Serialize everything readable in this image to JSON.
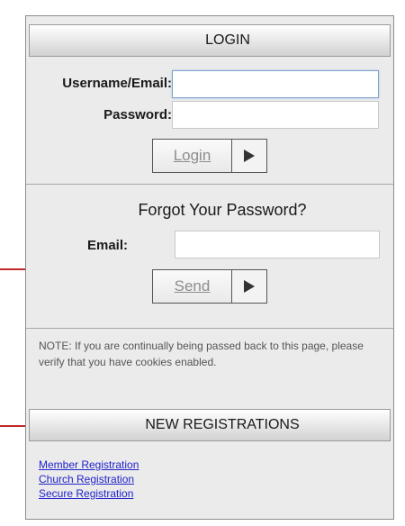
{
  "login": {
    "header": "LOGIN",
    "username_label": "Username/Email:",
    "username_value": "",
    "password_label": "Password:",
    "password_value": "",
    "login_button": "Login"
  },
  "forgot": {
    "title": "Forgot Your Password?",
    "email_label": "Email:",
    "email_value": "",
    "send_button": "Send"
  },
  "note": "NOTE: If you are continually being passed back to this page, please verify that you have cookies enabled.",
  "registrations": {
    "header": "NEW REGISTRATIONS",
    "links": [
      "Member Registration",
      "Church Registration",
      "Secure Registration"
    ]
  },
  "colors": {
    "annotation_arrow": "#c0282a",
    "link": "#2222cc"
  },
  "icons": {
    "button_arrow": "play-triangle-icon",
    "annotation": "red-arrow-icon"
  }
}
